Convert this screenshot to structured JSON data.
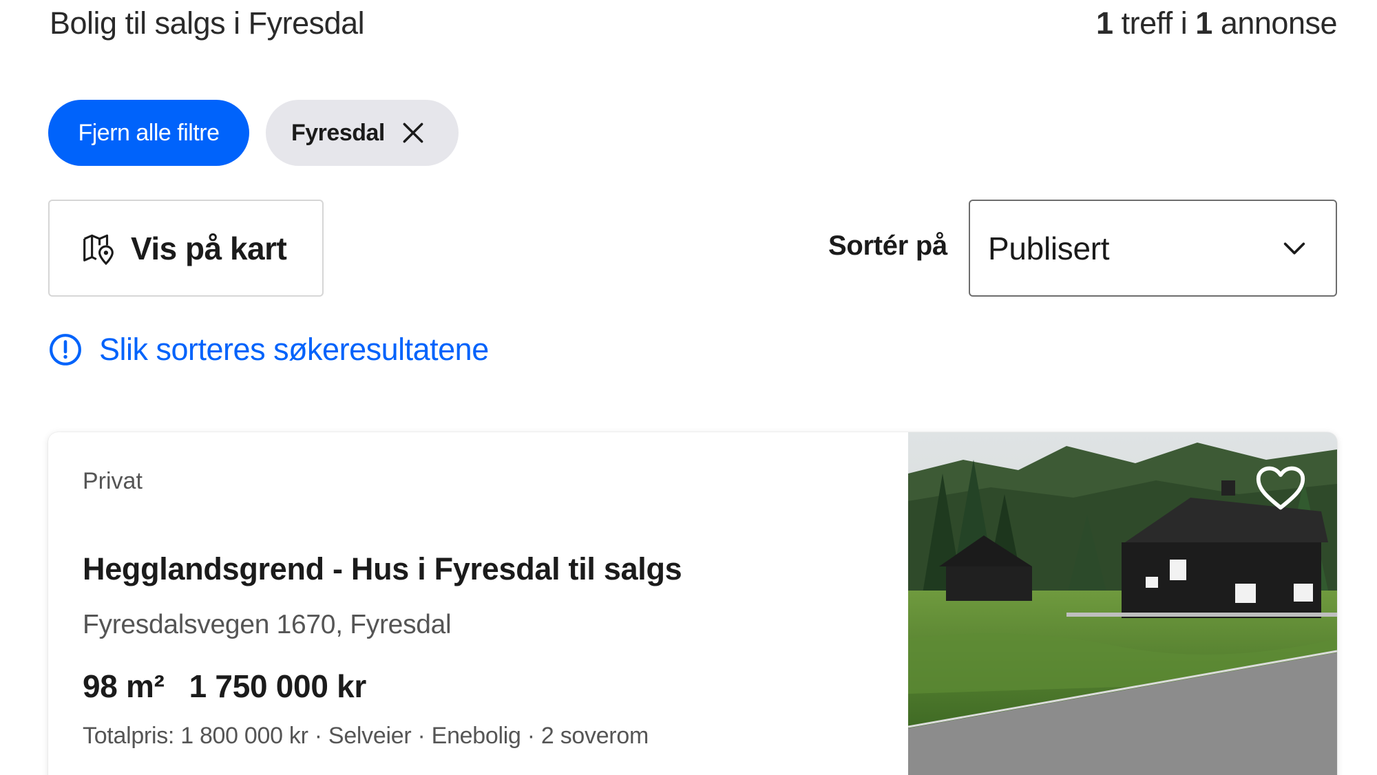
{
  "header": {
    "title": "Bolig til salgs i Fyresdal",
    "count_num1": "1",
    "count_mid": " treff i ",
    "count_num2": "1",
    "count_end": " annonse"
  },
  "filters": {
    "clear_all_label": "Fjern alle filtre",
    "active": [
      {
        "label": "Fyresdal",
        "remove_icon": "close-icon"
      }
    ]
  },
  "toolbar": {
    "map_button_label": "Vis på kart",
    "map_icon": "map-pin-icon",
    "sort_label": "Sortér på",
    "sort_value": "Publisert",
    "sort_icon": "chevron-down-icon"
  },
  "info": {
    "link_text": "Slik sorteres søkeresultatene",
    "icon": "info-circle-icon"
  },
  "listings": [
    {
      "seller": "Privat",
      "title": "Hegglandsgrend - Hus i Fyresdal til salgs",
      "address": "Fyresdalsvegen 1670, Fyresdal",
      "size": "98 m²",
      "price": "1 750 000 kr",
      "details": "Totalpris: 1 800 000 kr · Selveier · Enebolig · 2 soverom",
      "favorite_icon": "heart-icon"
    }
  ],
  "colors": {
    "accent": "#0063fb",
    "chip_bg": "#e6e6eb",
    "text": "#1b1b1b",
    "muted": "#555555"
  }
}
